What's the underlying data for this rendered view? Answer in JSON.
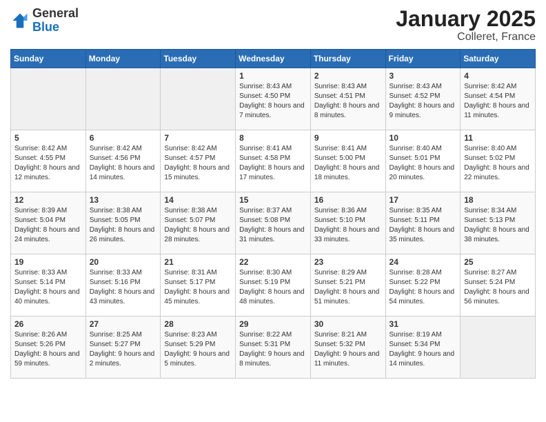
{
  "logo": {
    "general": "General",
    "blue": "Blue"
  },
  "title": "January 2025",
  "subtitle": "Colleret, France",
  "days_header": [
    "Sunday",
    "Monday",
    "Tuesday",
    "Wednesday",
    "Thursday",
    "Friday",
    "Saturday"
  ],
  "weeks": [
    [
      {
        "day": "",
        "sunrise": "",
        "sunset": "",
        "daylight": ""
      },
      {
        "day": "",
        "sunrise": "",
        "sunset": "",
        "daylight": ""
      },
      {
        "day": "",
        "sunrise": "",
        "sunset": "",
        "daylight": ""
      },
      {
        "day": "1",
        "sunrise": "Sunrise: 8:43 AM",
        "sunset": "Sunset: 4:50 PM",
        "daylight": "Daylight: 8 hours and 7 minutes."
      },
      {
        "day": "2",
        "sunrise": "Sunrise: 8:43 AM",
        "sunset": "Sunset: 4:51 PM",
        "daylight": "Daylight: 8 hours and 8 minutes."
      },
      {
        "day": "3",
        "sunrise": "Sunrise: 8:43 AM",
        "sunset": "Sunset: 4:52 PM",
        "daylight": "Daylight: 8 hours and 9 minutes."
      },
      {
        "day": "4",
        "sunrise": "Sunrise: 8:42 AM",
        "sunset": "Sunset: 4:54 PM",
        "daylight": "Daylight: 8 hours and 11 minutes."
      }
    ],
    [
      {
        "day": "5",
        "sunrise": "Sunrise: 8:42 AM",
        "sunset": "Sunset: 4:55 PM",
        "daylight": "Daylight: 8 hours and 12 minutes."
      },
      {
        "day": "6",
        "sunrise": "Sunrise: 8:42 AM",
        "sunset": "Sunset: 4:56 PM",
        "daylight": "Daylight: 8 hours and 14 minutes."
      },
      {
        "day": "7",
        "sunrise": "Sunrise: 8:42 AM",
        "sunset": "Sunset: 4:57 PM",
        "daylight": "Daylight: 8 hours and 15 minutes."
      },
      {
        "day": "8",
        "sunrise": "Sunrise: 8:41 AM",
        "sunset": "Sunset: 4:58 PM",
        "daylight": "Daylight: 8 hours and 17 minutes."
      },
      {
        "day": "9",
        "sunrise": "Sunrise: 8:41 AM",
        "sunset": "Sunset: 5:00 PM",
        "daylight": "Daylight: 8 hours and 18 minutes."
      },
      {
        "day": "10",
        "sunrise": "Sunrise: 8:40 AM",
        "sunset": "Sunset: 5:01 PM",
        "daylight": "Daylight: 8 hours and 20 minutes."
      },
      {
        "day": "11",
        "sunrise": "Sunrise: 8:40 AM",
        "sunset": "Sunset: 5:02 PM",
        "daylight": "Daylight: 8 hours and 22 minutes."
      }
    ],
    [
      {
        "day": "12",
        "sunrise": "Sunrise: 8:39 AM",
        "sunset": "Sunset: 5:04 PM",
        "daylight": "Daylight: 8 hours and 24 minutes."
      },
      {
        "day": "13",
        "sunrise": "Sunrise: 8:38 AM",
        "sunset": "Sunset: 5:05 PM",
        "daylight": "Daylight: 8 hours and 26 minutes."
      },
      {
        "day": "14",
        "sunrise": "Sunrise: 8:38 AM",
        "sunset": "Sunset: 5:07 PM",
        "daylight": "Daylight: 8 hours and 28 minutes."
      },
      {
        "day": "15",
        "sunrise": "Sunrise: 8:37 AM",
        "sunset": "Sunset: 5:08 PM",
        "daylight": "Daylight: 8 hours and 31 minutes."
      },
      {
        "day": "16",
        "sunrise": "Sunrise: 8:36 AM",
        "sunset": "Sunset: 5:10 PM",
        "daylight": "Daylight: 8 hours and 33 minutes."
      },
      {
        "day": "17",
        "sunrise": "Sunrise: 8:35 AM",
        "sunset": "Sunset: 5:11 PM",
        "daylight": "Daylight: 8 hours and 35 minutes."
      },
      {
        "day": "18",
        "sunrise": "Sunrise: 8:34 AM",
        "sunset": "Sunset: 5:13 PM",
        "daylight": "Daylight: 8 hours and 38 minutes."
      }
    ],
    [
      {
        "day": "19",
        "sunrise": "Sunrise: 8:33 AM",
        "sunset": "Sunset: 5:14 PM",
        "daylight": "Daylight: 8 hours and 40 minutes."
      },
      {
        "day": "20",
        "sunrise": "Sunrise: 8:33 AM",
        "sunset": "Sunset: 5:16 PM",
        "daylight": "Daylight: 8 hours and 43 minutes."
      },
      {
        "day": "21",
        "sunrise": "Sunrise: 8:31 AM",
        "sunset": "Sunset: 5:17 PM",
        "daylight": "Daylight: 8 hours and 45 minutes."
      },
      {
        "day": "22",
        "sunrise": "Sunrise: 8:30 AM",
        "sunset": "Sunset: 5:19 PM",
        "daylight": "Daylight: 8 hours and 48 minutes."
      },
      {
        "day": "23",
        "sunrise": "Sunrise: 8:29 AM",
        "sunset": "Sunset: 5:21 PM",
        "daylight": "Daylight: 8 hours and 51 minutes."
      },
      {
        "day": "24",
        "sunrise": "Sunrise: 8:28 AM",
        "sunset": "Sunset: 5:22 PM",
        "daylight": "Daylight: 8 hours and 54 minutes."
      },
      {
        "day": "25",
        "sunrise": "Sunrise: 8:27 AM",
        "sunset": "Sunset: 5:24 PM",
        "daylight": "Daylight: 8 hours and 56 minutes."
      }
    ],
    [
      {
        "day": "26",
        "sunrise": "Sunrise: 8:26 AM",
        "sunset": "Sunset: 5:26 PM",
        "daylight": "Daylight: 8 hours and 59 minutes."
      },
      {
        "day": "27",
        "sunrise": "Sunrise: 8:25 AM",
        "sunset": "Sunset: 5:27 PM",
        "daylight": "Daylight: 9 hours and 2 minutes."
      },
      {
        "day": "28",
        "sunrise": "Sunrise: 8:23 AM",
        "sunset": "Sunset: 5:29 PM",
        "daylight": "Daylight: 9 hours and 5 minutes."
      },
      {
        "day": "29",
        "sunrise": "Sunrise: 8:22 AM",
        "sunset": "Sunset: 5:31 PM",
        "daylight": "Daylight: 9 hours and 8 minutes."
      },
      {
        "day": "30",
        "sunrise": "Sunrise: 8:21 AM",
        "sunset": "Sunset: 5:32 PM",
        "daylight": "Daylight: 9 hours and 11 minutes."
      },
      {
        "day": "31",
        "sunrise": "Sunrise: 8:19 AM",
        "sunset": "Sunset: 5:34 PM",
        "daylight": "Daylight: 9 hours and 14 minutes."
      },
      {
        "day": "",
        "sunrise": "",
        "sunset": "",
        "daylight": ""
      }
    ]
  ]
}
